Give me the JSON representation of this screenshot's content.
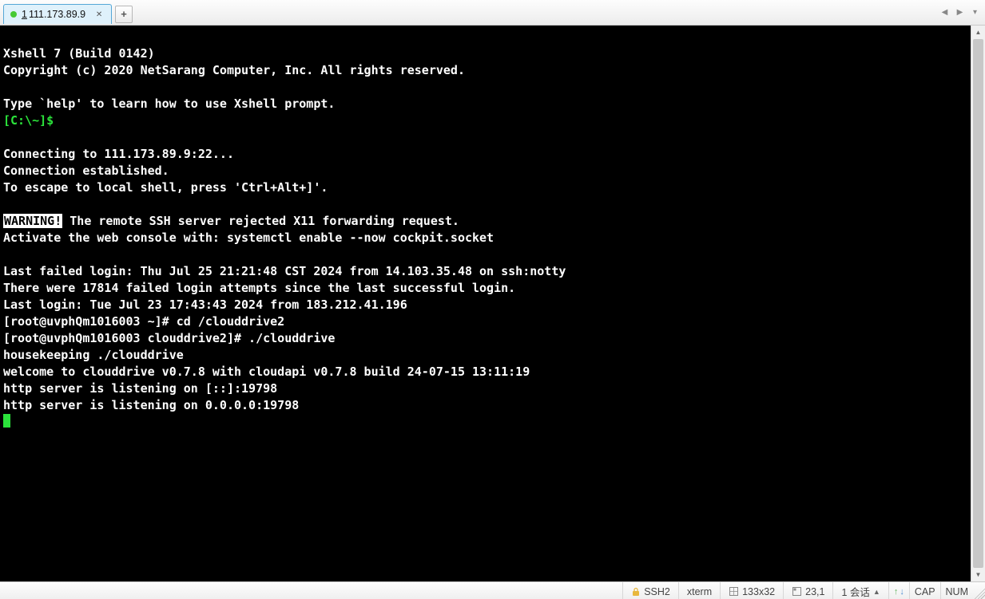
{
  "tabs": {
    "active": {
      "index": "1",
      "title": "111.173.89.9"
    }
  },
  "terminal": {
    "lines": {
      "l0": "Xshell 7 (Build 0142)",
      "l1": "Copyright (c) 2020 NetSarang Computer, Inc. All rights reserved.",
      "l2": "",
      "l3": "Type `help' to learn how to use Xshell prompt.",
      "prompt": "[C:\\~]$",
      "l4": "",
      "l5": "Connecting to 111.173.89.9:22...",
      "l6": "Connection established.",
      "l7": "To escape to local shell, press 'Ctrl+Alt+]'.",
      "l8": "",
      "warn": "WARNING!",
      "warn_rest": " The remote SSH server rejected X11 forwarding request.",
      "l9": "Activate the web console with: systemctl enable --now cockpit.socket",
      "l10": "",
      "l11": "Last failed login: Thu Jul 25 21:21:48 CST 2024 from 14.103.35.48 on ssh:notty",
      "l12": "There were 17814 failed login attempts since the last successful login.",
      "l13": "Last login: Tue Jul 23 17:43:43 2024 from 183.212.41.196",
      "l14": "[root@uvphQm1016003 ~]# cd /clouddrive2",
      "l15": "[root@uvphQm1016003 clouddrive2]# ./clouddrive",
      "l16": "housekeeping ./clouddrive",
      "l17": "welcome to clouddrive v0.7.8 with cloudapi v0.7.8 build 24-07-15 13:11:19",
      "l18": "http server is listening on [::]:19798",
      "l19": "http server is listening on 0.0.0.0:19798"
    }
  },
  "status": {
    "protocol": "SSH2",
    "term": "xterm",
    "size": "133x32",
    "cursor": "23,1",
    "sessions": "1 会话",
    "cap": "CAP",
    "num": "NUM"
  }
}
